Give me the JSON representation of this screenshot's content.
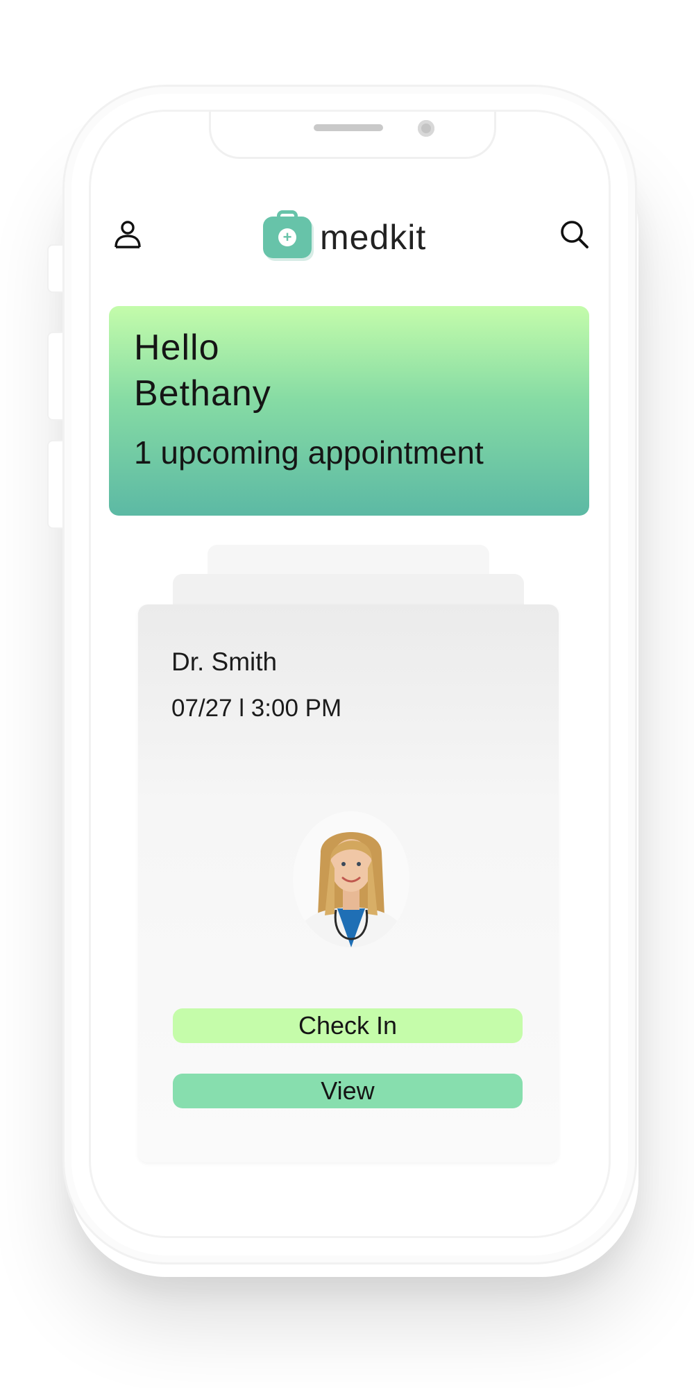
{
  "app": {
    "name": "medkit",
    "brand_color": "#67c3a9"
  },
  "header": {
    "profile_icon": "user-icon",
    "search_icon": "search-icon",
    "logo_icon": "first-aid-kit-icon"
  },
  "greeting": {
    "hello": "Hello",
    "user_name": "Bethany",
    "summary": "1 upcoming appointment",
    "gradient_top": "#c4fcab",
    "gradient_bottom": "#5cb9a4"
  },
  "appointment": {
    "doctor": "Dr. Smith",
    "datetime": "07/27 l 3:00 PM",
    "avatar": "doctor-photo",
    "check_in_label": "Check In",
    "view_label": "View",
    "check_in_color": "#c5fcaa",
    "view_color": "#87deae"
  }
}
